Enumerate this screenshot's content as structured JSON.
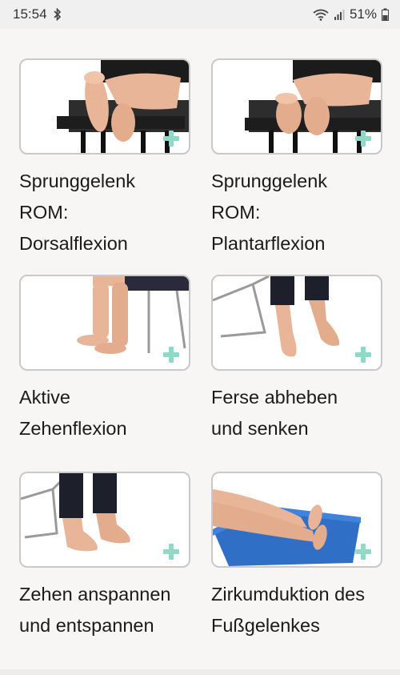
{
  "status_bar": {
    "time": "15:54",
    "battery": "51%",
    "icons": [
      "bluetooth-icon",
      "wifi-icon",
      "signal-icon",
      "battery-icon"
    ]
  },
  "exercises": [
    {
      "title": "Sprunggelenk\nROM:\nDorsalflexion",
      "image": "feet-on-bench"
    },
    {
      "title": "Sprunggelenk\nROM:\nPlantarflexion",
      "image": "feet-on-bench-pointed"
    },
    {
      "title": "Aktive\nZehenflexion",
      "image": "seated-feet"
    },
    {
      "title": "Ferse abheben\nund senken",
      "image": "heel-raise"
    },
    {
      "title": "Zehen anspannen\nund entspannen",
      "image": "toes-on-floor"
    },
    {
      "title": "Zirkumduktion des\nFußgelenkes",
      "image": "legs-on-mat"
    }
  ],
  "colors": {
    "accent_plus": "#8fd9c8",
    "mat_blue": "#2f6fc6",
    "skin": "#e8b598"
  }
}
